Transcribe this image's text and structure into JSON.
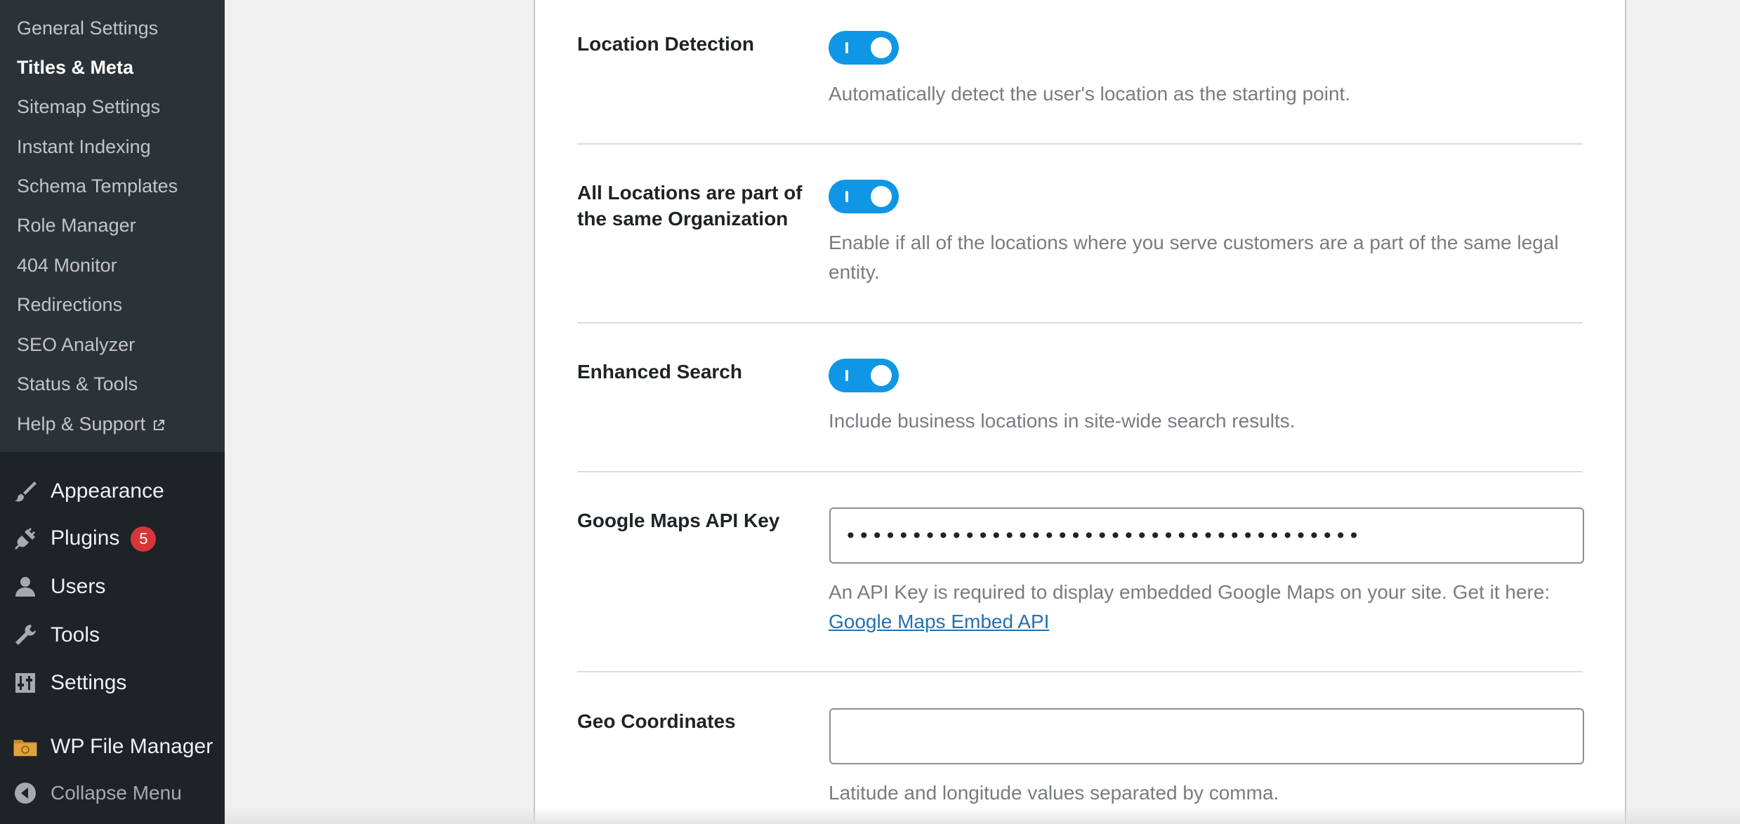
{
  "sidebar": {
    "submenu": [
      {
        "label": "General Settings",
        "current": false
      },
      {
        "label": "Titles & Meta",
        "current": true
      },
      {
        "label": "Sitemap Settings",
        "current": false
      },
      {
        "label": "Instant Indexing",
        "current": false
      },
      {
        "label": "Schema Templates",
        "current": false
      },
      {
        "label": "Role Manager",
        "current": false
      },
      {
        "label": "404 Monitor",
        "current": false
      },
      {
        "label": "Redirections",
        "current": false
      },
      {
        "label": "SEO Analyzer",
        "current": false
      },
      {
        "label": "Status & Tools",
        "current": false
      },
      {
        "label": "Help & Support",
        "current": false,
        "external_icon": "external-link-icon"
      }
    ],
    "menu": [
      {
        "label": "Appearance",
        "icon": "paintbrush-icon"
      },
      {
        "label": "Plugins",
        "icon": "plugin-icon",
        "badge": "5"
      },
      {
        "label": "Users",
        "icon": "user-icon"
      },
      {
        "label": "Tools",
        "icon": "wrench-icon"
      },
      {
        "label": "Settings",
        "icon": "settings-sliders-icon"
      },
      {
        "label": "WP File Manager",
        "icon": "folder-icon"
      },
      {
        "label": "Collapse Menu",
        "icon": "collapse-arrow-icon"
      }
    ],
    "colors": {
      "background": "#1d2327",
      "submenu_bg": "#2c3338",
      "badge": "#d63638"
    }
  },
  "settings": {
    "location_detection": {
      "label": "Location Detection",
      "enabled": true,
      "description": "Automatically detect the user's location as the starting point."
    },
    "same_organization": {
      "label_line1": "All Locations are part of",
      "label_line2": "the same Organization",
      "enabled": true,
      "description": "Enable if all of the locations where you serve customers are a part of the same legal entity."
    },
    "enhanced_search": {
      "label": "Enhanced Search",
      "enabled": true,
      "description": "Include business locations in site-wide search results."
    },
    "google_maps_api_key": {
      "label": "Google Maps API Key",
      "value": "•••••••••••••••••••••••••••••••••••••••",
      "description": "An API Key is required to display embedded Google Maps on your site. Get it here:",
      "link_text": "Google Maps Embed API"
    },
    "geo_coordinates": {
      "label": "Geo Coordinates",
      "value": "",
      "placeholder": "",
      "description": "Latitude and longitude values separated by comma."
    }
  },
  "colors": {
    "toggle_on": "#0f97e6",
    "link": "#2271b1",
    "description_text": "#787c82"
  }
}
